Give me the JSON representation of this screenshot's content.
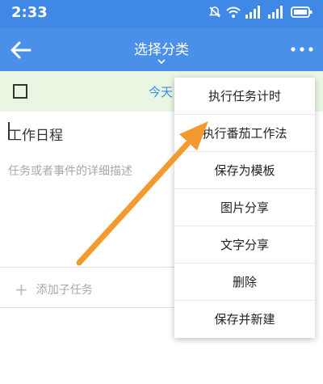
{
  "status_bar": {
    "time": "2:33"
  },
  "app_bar": {
    "title": "选择分类"
  },
  "task": {
    "date_label": "今天",
    "title": "工作日程",
    "description_placeholder": "任务或者事件的详细描述",
    "add_subtask_label": "添加子任务"
  },
  "menu": {
    "items": [
      {
        "label": "执行任务计时"
      },
      {
        "label": "执行番茄工作法"
      },
      {
        "label": "保存为模板"
      },
      {
        "label": "图片分享"
      },
      {
        "label": "文字分享"
      },
      {
        "label": "删除"
      },
      {
        "label": "保存并新建"
      }
    ]
  },
  "colors": {
    "primary": "#4a90e8",
    "status_bar": "#3f88e6",
    "date_row_bg": "#e9f7e2",
    "annotation_arrow": "#f29a2e"
  }
}
